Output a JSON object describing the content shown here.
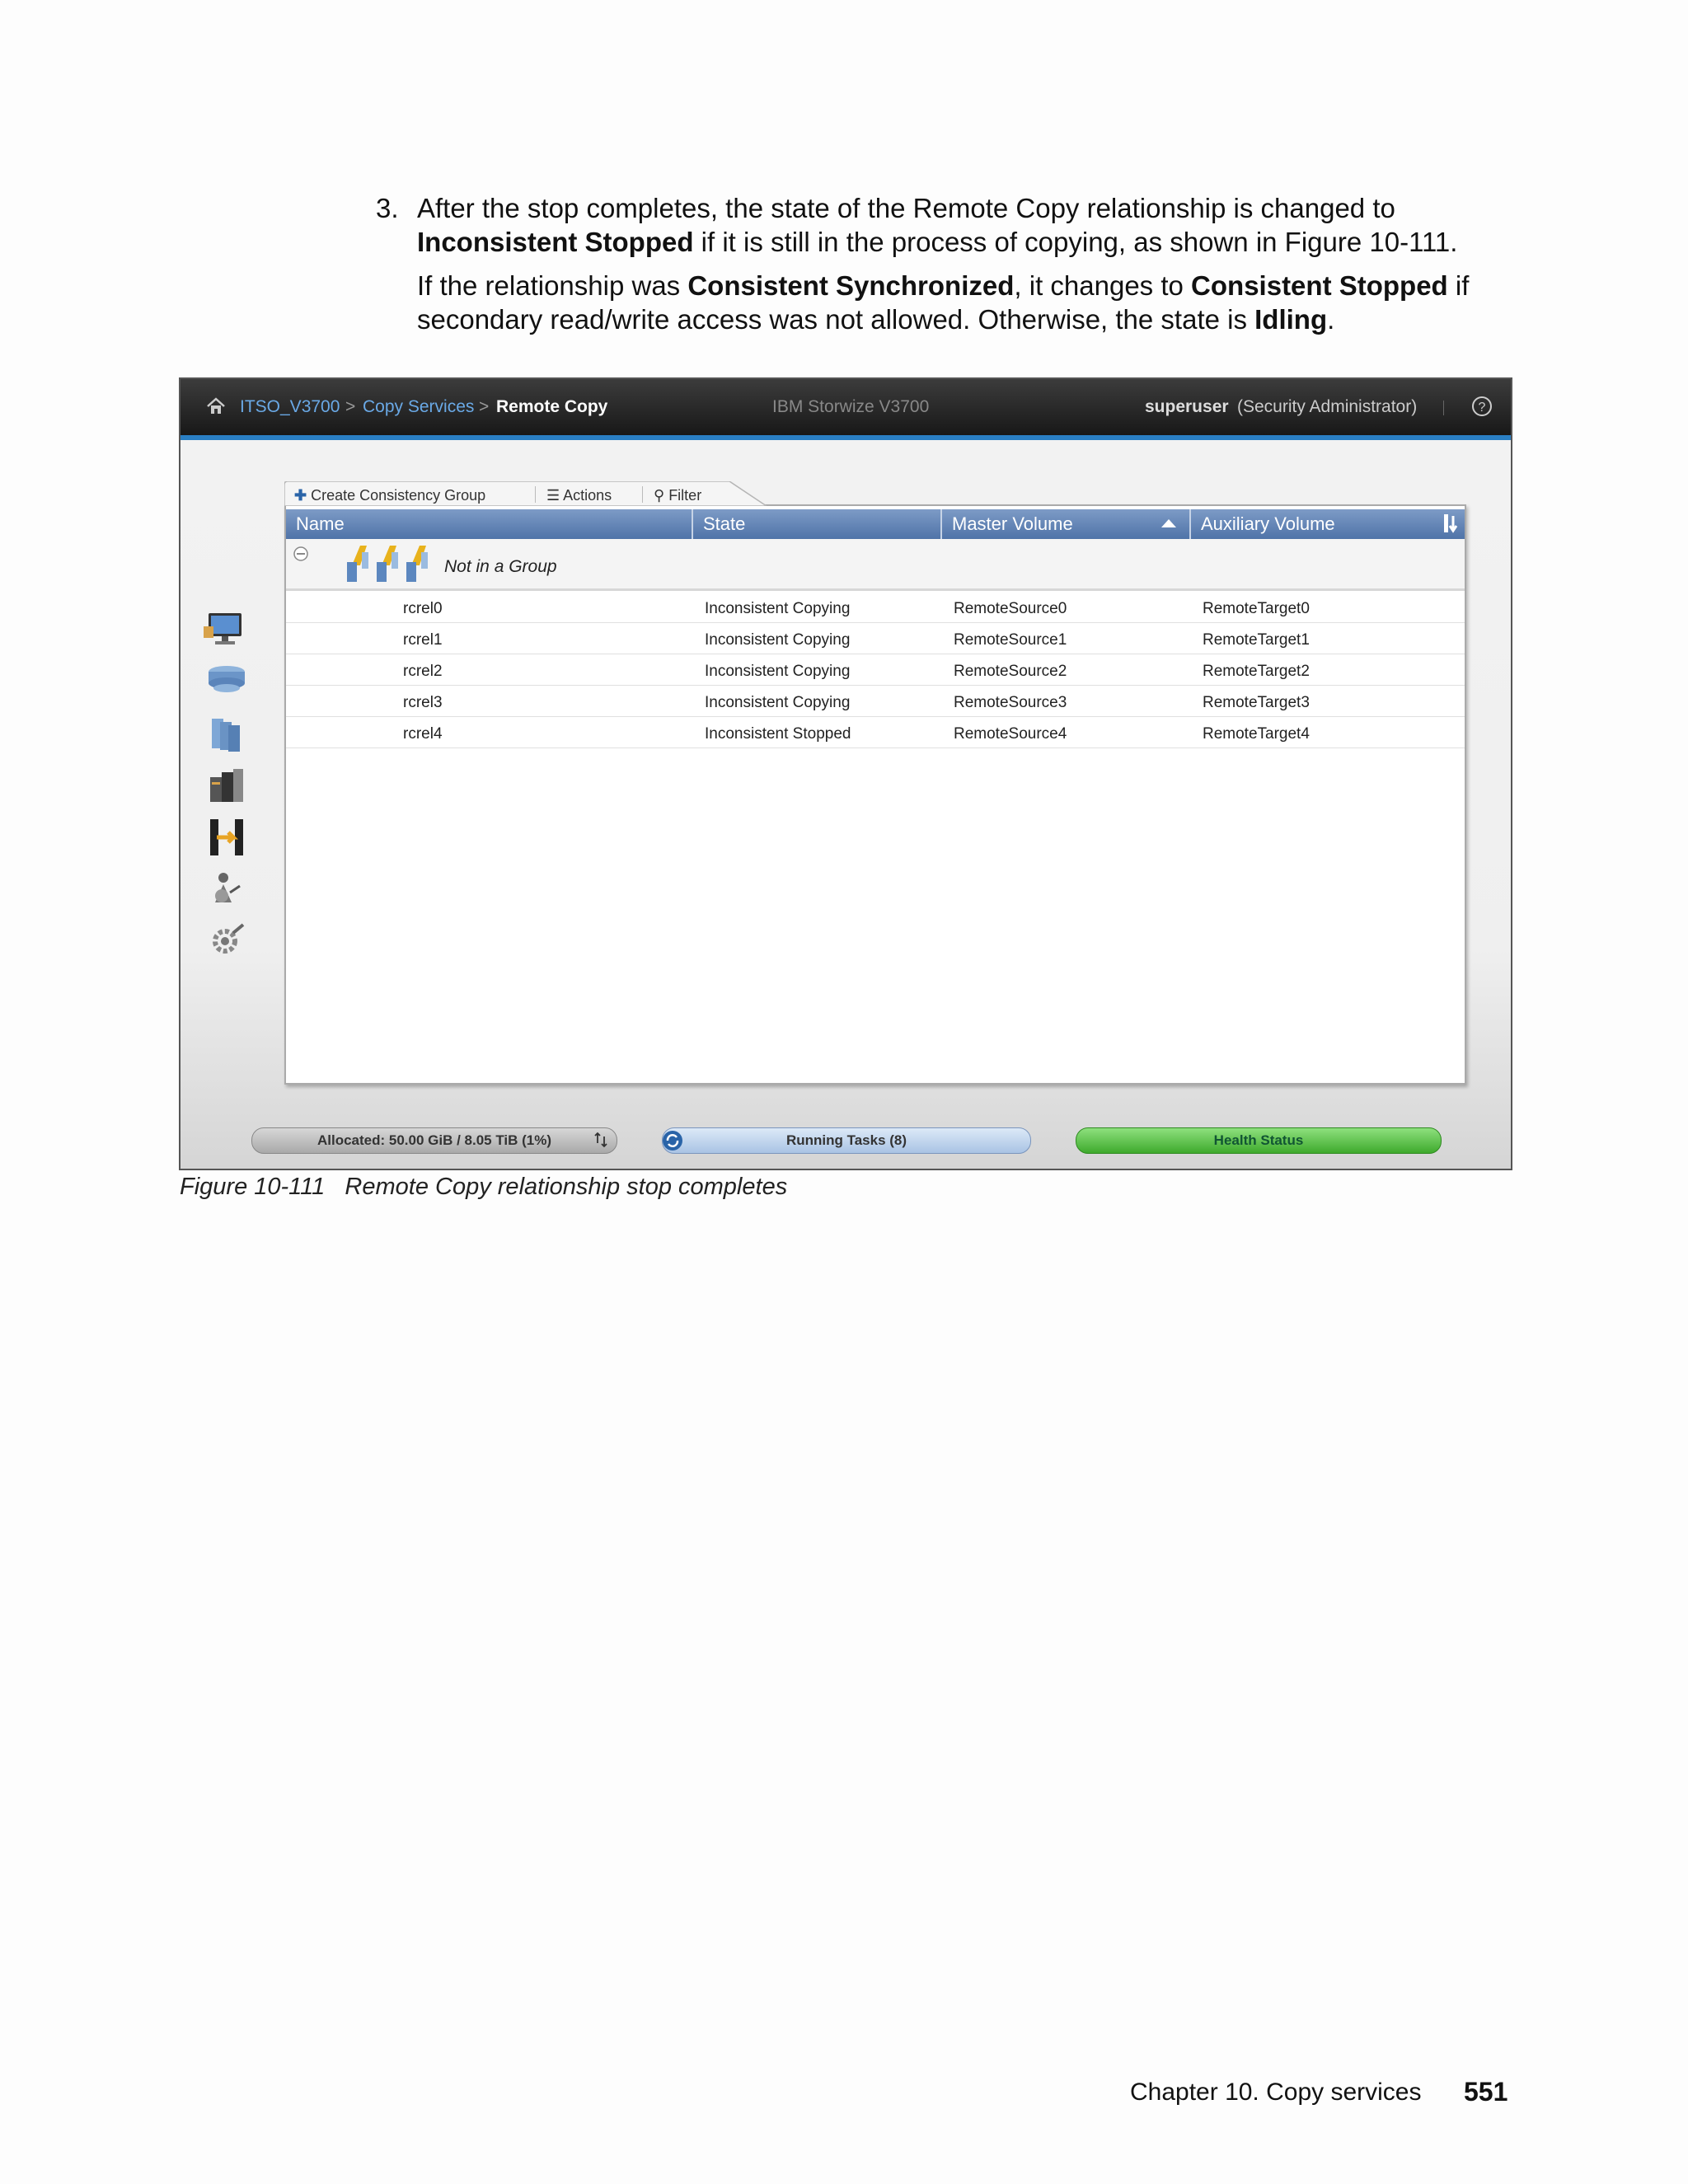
{
  "document": {
    "step_number": "3.",
    "paragraph1": [
      {
        "text": "After the stop completes, the state of the Remote Copy relationship is changed to ",
        "bold": false
      },
      {
        "text": "Inconsistent Stopped",
        "bold": true
      },
      {
        "text": " if it is still in the process of copying, as shown in Figure 10-111.",
        "bold": false
      }
    ],
    "paragraph2": [
      {
        "text": "If the relationship was ",
        "bold": false
      },
      {
        "text": "Consistent Synchronized",
        "bold": true
      },
      {
        "text": ", it changes to ",
        "bold": false
      },
      {
        "text": "Consistent Stopped",
        "bold": true
      },
      {
        "text": " if secondary read/write access was not allowed. Otherwise, the state is ",
        "bold": false
      },
      {
        "text": "Idling",
        "bold": true
      },
      {
        "text": ".",
        "bold": false
      }
    ],
    "caption": "Figure 10-111   Remote Copy relationship stop completes",
    "footer": {
      "chapter": "Chapter 10. Copy services",
      "page": "551"
    }
  },
  "screenshot": {
    "breadcrumb": {
      "root": "ITSO_V3700",
      "level1": "Copy Services",
      "current": "Remote Copy",
      "separator": ">"
    },
    "product": "IBM Storwize V3700",
    "user": "superuser",
    "role": "(Security Administrator)",
    "nav_icons": [
      "monitoring-icon",
      "pools-icon",
      "volumes-icon",
      "hosts-icon",
      "copy-services-icon",
      "access-icon",
      "settings-icon"
    ],
    "toolbar": {
      "create": "Create Consistency Group",
      "actions": "Actions",
      "filter": "Filter"
    },
    "columns": [
      "Name",
      "State",
      "Master Volume",
      "Auxiliary Volume"
    ],
    "group_label": "Not in a Group",
    "rows": [
      {
        "name": "rcrel0",
        "state": "Inconsistent Copying",
        "master": "RemoteSource0",
        "aux": "RemoteTarget0"
      },
      {
        "name": "rcrel1",
        "state": "Inconsistent Copying",
        "master": "RemoteSource1",
        "aux": "RemoteTarget1"
      },
      {
        "name": "rcrel2",
        "state": "Inconsistent Copying",
        "master": "RemoteSource2",
        "aux": "RemoteTarget2"
      },
      {
        "name": "rcrel3",
        "state": "Inconsistent Copying",
        "master": "RemoteSource3",
        "aux": "RemoteTarget3"
      },
      {
        "name": "rcrel4",
        "state": "Inconsistent Stopped",
        "master": "RemoteSource4",
        "aux": "RemoteTarget4"
      }
    ],
    "status": {
      "allocated": "Allocated: 50.00 GiB / 8.05 TiB (1%)",
      "tasks": "Running Tasks (8)",
      "health": "Health Status"
    },
    "colors": {
      "header_blue": "#5a7cb0",
      "accent_blue": "#2a7fc4",
      "health_green": "#4cbf3a"
    }
  }
}
